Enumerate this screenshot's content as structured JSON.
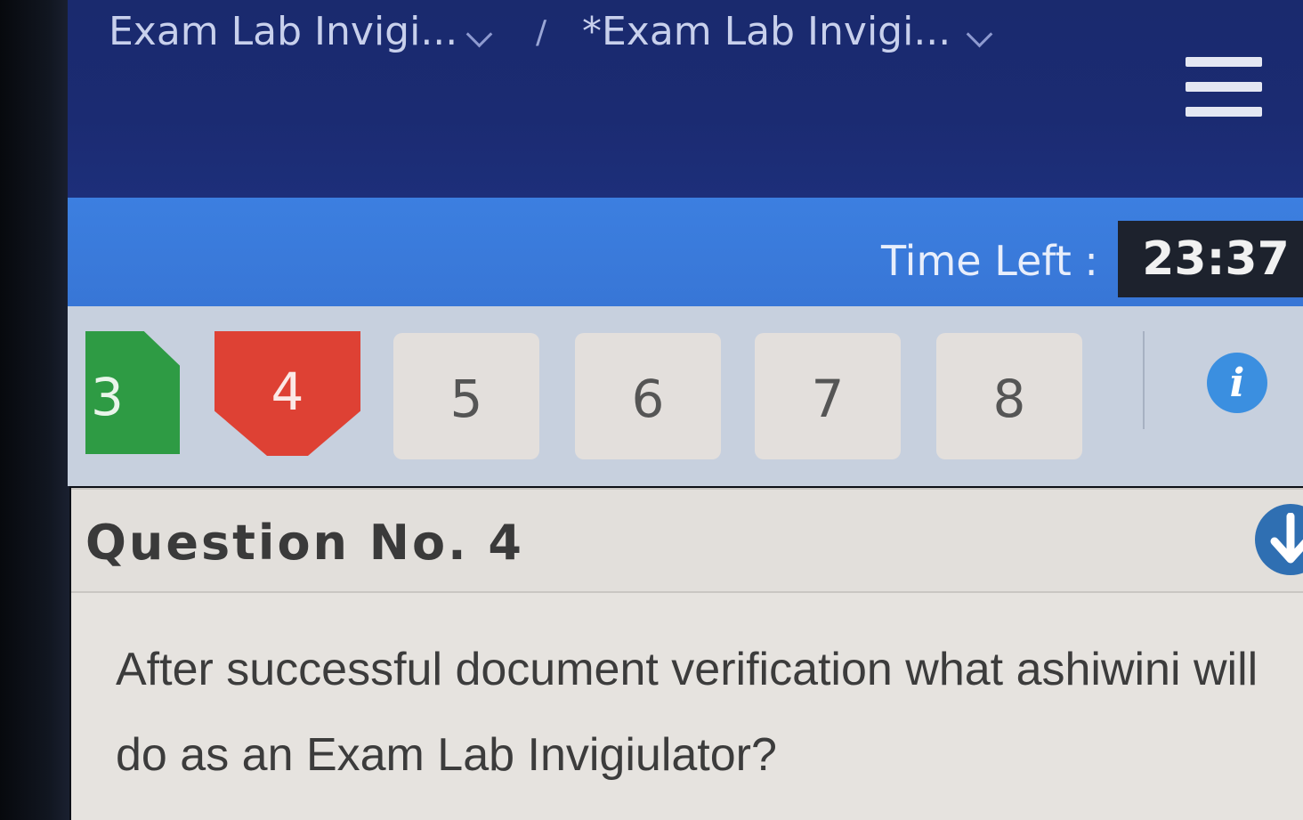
{
  "breadcrumb": {
    "item1": "Exam Lab Invigi...",
    "separator": "/",
    "item2": "*Exam Lab Invigi..."
  },
  "timer": {
    "label": "Time Left :",
    "value": "23:37"
  },
  "question_nav": {
    "items": [
      {
        "number": "3",
        "status": "answered"
      },
      {
        "number": "4",
        "status": "current"
      },
      {
        "number": "5",
        "status": "unvisited"
      },
      {
        "number": "6",
        "status": "unvisited"
      },
      {
        "number": "7",
        "status": "unvisited"
      },
      {
        "number": "8",
        "status": "unvisited"
      }
    ]
  },
  "question": {
    "title": "Question No. 4",
    "text": "After successful document verification what ashiwini will do as an Exam Lab Invigiulator?"
  },
  "colors": {
    "header": "#1b2b72",
    "timer_bar": "#3a7ad9",
    "answered": "#2e9b44",
    "current": "#de4134",
    "info": "#3b8fe0"
  },
  "icons": {
    "menu": "hamburger-menu-icon",
    "info": "info-icon",
    "scroll": "arrow-down-icon",
    "dropdown": "chevron-down-icon"
  }
}
